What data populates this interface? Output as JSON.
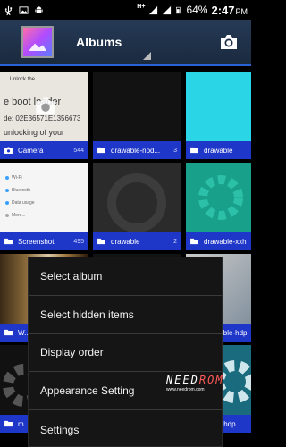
{
  "status_bar": {
    "network": "H+",
    "battery": "64%",
    "time": "2:47",
    "ampm": "PM"
  },
  "action_bar": {
    "title": "Albums"
  },
  "albums": [
    {
      "name": "Camera",
      "count": "544",
      "thumb_text": [
        "... Unlock the ...",
        "e boot loader",
        "de: 02E36571E1356673",
        "unlocking of your"
      ]
    },
    {
      "name": "drawable-nod...",
      "count": "3"
    },
    {
      "name": "drawable",
      "count": ""
    },
    {
      "name": "Screenshot",
      "count": "495",
      "thumb_text": [
        "Wi-Fi",
        "Bluetooth",
        "Data usage",
        "More..."
      ]
    },
    {
      "name": "drawable",
      "count": "2"
    },
    {
      "name": "drawable-xxh",
      "count": ""
    },
    {
      "name": "W...",
      "count": ""
    },
    {
      "name": "",
      "count": ""
    },
    {
      "name": "drawable-hdp",
      "count": ""
    },
    {
      "name": "m...",
      "count": ""
    },
    {
      "name": "",
      "count": ""
    },
    {
      "name": "map-xhdp",
      "count": ""
    }
  ],
  "menu": {
    "items": [
      "Select album",
      "Select hidden items",
      "Display order",
      "Appearance Setting",
      "Settings"
    ]
  },
  "watermark": {
    "logo_left": "NEED",
    "logo_right": "ROM",
    "url": "www.needrom.com"
  },
  "colors": {
    "label_bar": "#1f37c9",
    "action_bar_accent": "#2a62d6"
  }
}
